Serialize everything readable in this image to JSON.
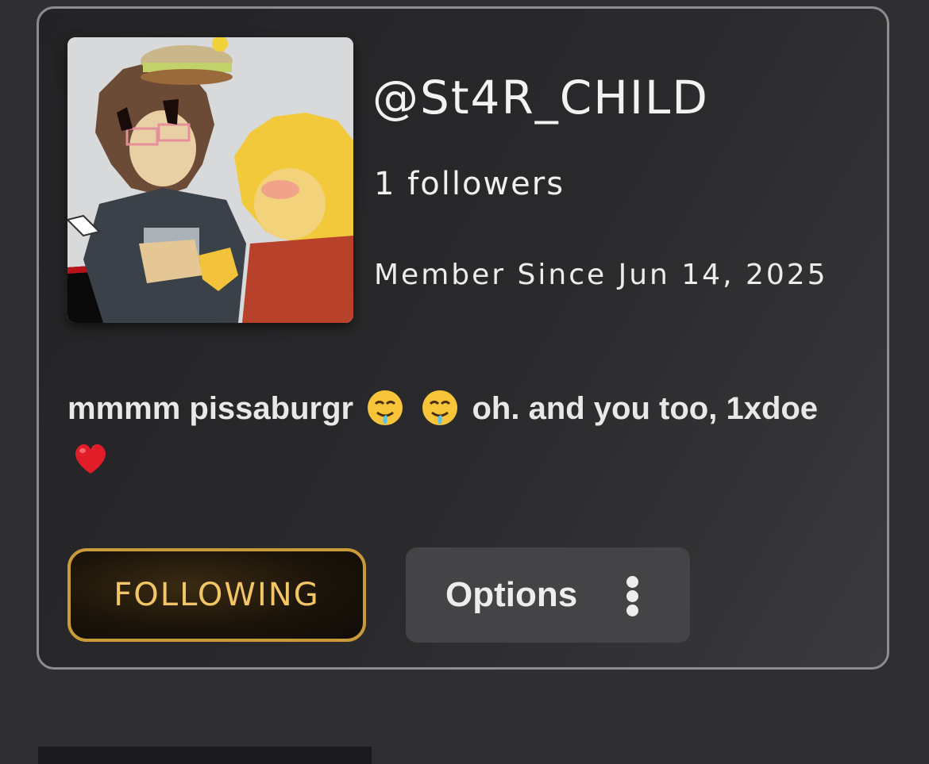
{
  "profile": {
    "username": "@St4R_CHILD",
    "followers": "1 followers",
    "member_since": "Member Since Jun 14, 2025",
    "bio": {
      "text_before": "mmmm pissaburgr",
      "emoji_1": "drooling-face",
      "emoji_2": "drooling-face",
      "text_after": "oh. and you too, 1xdoe",
      "emoji_3": "red-heart"
    }
  },
  "actions": {
    "following_label": "FOLLOWING",
    "options_label": "Options",
    "options_icon": "kebab-menu-icon"
  },
  "colors": {
    "background": "#2f2f33",
    "card_border": "#8d8d90",
    "following_text": "#f2c566",
    "following_border": "#c99a3a",
    "options_bg": "#444446"
  }
}
